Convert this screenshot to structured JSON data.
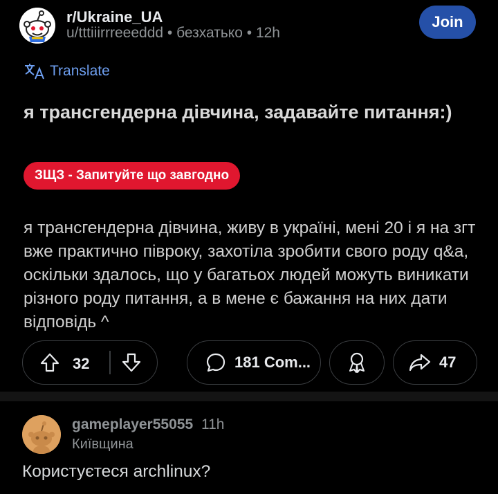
{
  "post": {
    "subreddit": "r/Ukraine_UA",
    "author": "u/tttiiirrreeeddd",
    "author_flair": "безхатько",
    "time": "12h",
    "join_label": "Join",
    "translate_label": "Translate",
    "title": "я трансгендерна дівчина, задавайте питання:)",
    "flair": "ЗЩЗ - Запитуйте що завгодно",
    "body": "я трансгендерна дівчина, живу в україні, мені 20 і я на згт вже практично півроку, захотіла зробити свого роду q&a, оскільки здалось, що у багатьох людей можуть виникати різного роду питання, а в мене є бажання на них дати відповідь ^",
    "votes": "32",
    "comments": "181 Com...",
    "shares": "47",
    "flair_color": "#e0172f",
    "join_color": "#2550a8"
  },
  "comment": {
    "username": "gameplayer55055",
    "time": "11h",
    "flair": "Київщина",
    "text": "Користуєтеся archlinux?"
  }
}
